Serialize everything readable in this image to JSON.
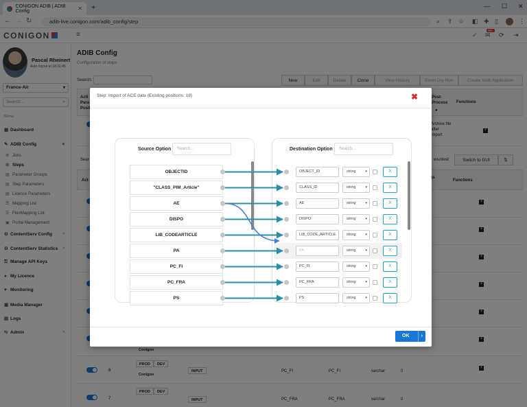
{
  "browser": {
    "tab_title": "CONIGON ADIB | ADIB Config",
    "url": "adib-live.conigon.com/adib_config/step"
  },
  "app": {
    "logo": "CONIGON",
    "notification_count": "99+"
  },
  "user": {
    "name": "Pascal Rheinert",
    "autologout": "Auto logout at 18:31:45",
    "tenant": "France-Air"
  },
  "sidebar": {
    "search_placeholder": "Search...",
    "menu_label": "Menu",
    "items": [
      {
        "label": "Dashboard"
      },
      {
        "label": "ADIB Config"
      },
      {
        "label": "ContentServ Config"
      },
      {
        "label": "ContentServ Statistics"
      },
      {
        "label": "Manage API Keys"
      },
      {
        "label": "My Licence"
      },
      {
        "label": "Monitoring"
      },
      {
        "label": "Media Manager"
      },
      {
        "label": "Logs"
      },
      {
        "label": "Admin"
      }
    ],
    "subitems": [
      {
        "label": "Jobs"
      },
      {
        "label": "Steps"
      },
      {
        "label": "Parameter Groups"
      },
      {
        "label": "Step Parameters"
      },
      {
        "label": "Licence Parameters"
      },
      {
        "label": "Mapping List"
      },
      {
        "label": "FlexMapping List"
      },
      {
        "label": "Portal Management"
      }
    ]
  },
  "page": {
    "title": "ADIB Config",
    "subtitle": "Configuration of steps",
    "search_label": "Search:",
    "buttons": {
      "new": "New",
      "edit": "Edit",
      "delete": "Delete",
      "clone": "Clone",
      "view_history": "View History",
      "excel_dry_run": "Excel Dry Run",
      "create_web_app": "Create Web Application"
    },
    "header": {
      "col1": "Acti Para Posit",
      "post_process": "Post-Process",
      "functions": "Functions",
      "archive_text": "Archive file after import"
    },
    "second_toolbar": {
      "search": "Sear",
      "ws_dest": "ws/dest",
      "switch_gui": "Switch to GUI"
    },
    "second_header": {
      "act": "Act",
      "ngs": "ngs",
      "functions": "Functions"
    },
    "rows": [
      {
        "pos": "6",
        "pill1": "PROD",
        "pill2": "DEV",
        "pill3": "Conigon",
        "type": "INPUT",
        "src": "PC_FI",
        "dst": "PC_FI",
        "dtype": "varchar",
        "len": "0"
      },
      {
        "pos": "7",
        "pill1": "PROD",
        "pill2": "DEV",
        "type": "INPUT",
        "src": "PC_FRA",
        "dst": "PC_FRA",
        "dtype": "varchar",
        "len": "0"
      }
    ],
    "row_above_pill": "Conigon"
  },
  "modal": {
    "title": "Step: Import of ACE data (Existing positions: 18)",
    "source_header": "Source Option",
    "destination_header": "Destination Option",
    "search_placeholder": "Search...",
    "ok_label": "OK",
    "source_rows": [
      "OBJECTID",
      "\"CLASS_PIM_Article\"",
      "AE",
      "DISPO",
      "LIB_CODEARTICLE",
      "PA",
      "PC_FI",
      "PC_FRA",
      "PS"
    ],
    "dest_rows": [
      {
        "value": "OBJECT_ID",
        "type": "string",
        "remove": "X"
      },
      {
        "value": "CLASS_ID",
        "type": "string",
        "remove": "X"
      },
      {
        "value": "AE",
        "type": "string",
        "remove": "X"
      },
      {
        "value": "DISPO",
        "type": "string",
        "remove": "X"
      },
      {
        "value": "LIB_CODE_ARTICLE",
        "type": "string",
        "remove": "X"
      },
      {
        "value": "PA",
        "type": "string",
        "remove": "X"
      },
      {
        "value": "PC_FI",
        "type": "string",
        "remove": "X"
      },
      {
        "value": "PC_FRA",
        "type": "string",
        "remove": "X"
      },
      {
        "value": "PS",
        "type": "string",
        "remove": "X"
      }
    ]
  },
  "colors": {
    "accent": "#1976d2",
    "connector": "#2a8fa6",
    "close": "#d32f2f"
  }
}
